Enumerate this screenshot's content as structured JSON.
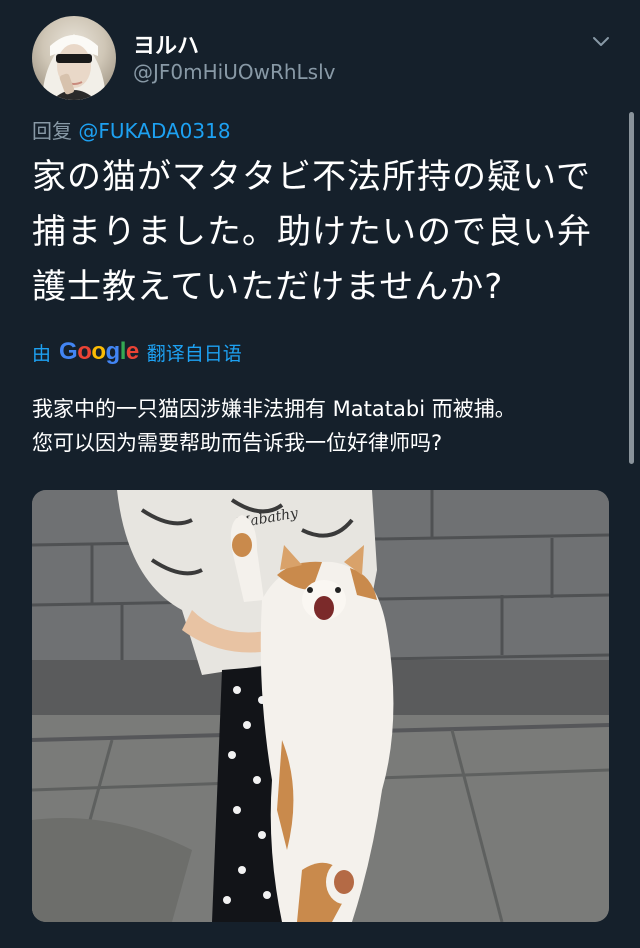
{
  "user": {
    "display_name": "ヨルハ",
    "handle": "@JF0mHiUOwRhLslv",
    "avatar_icon": "avatar-2b-icon"
  },
  "reply": {
    "prefix": "回复",
    "mention": "@FUKADA0318"
  },
  "tweet": {
    "lines": [
      "家の猫がマタタビ不法所持の疑いで",
      "捕まりました。助けたいので良い弁",
      "護士教えていただけませんか?"
    ]
  },
  "translation": {
    "by_label": "由",
    "brand": [
      "G",
      "o",
      "o",
      "g",
      "l",
      "e"
    ],
    "action_label": "翻译自日语",
    "lines": [
      "我家中的一只猫因涉嫌非法拥有 Matatabi 而被捕。",
      "您可以因为需要帮助而告诉我一位好律师吗?"
    ]
  },
  "media": {
    "description_icon": "cat-held-up-photo",
    "shirt_text": "Mabathy"
  },
  "colors": {
    "background": "#15202b",
    "accent": "#1da1f2",
    "secondary_text": "#8899a6",
    "primary_text": "#ffffff"
  }
}
